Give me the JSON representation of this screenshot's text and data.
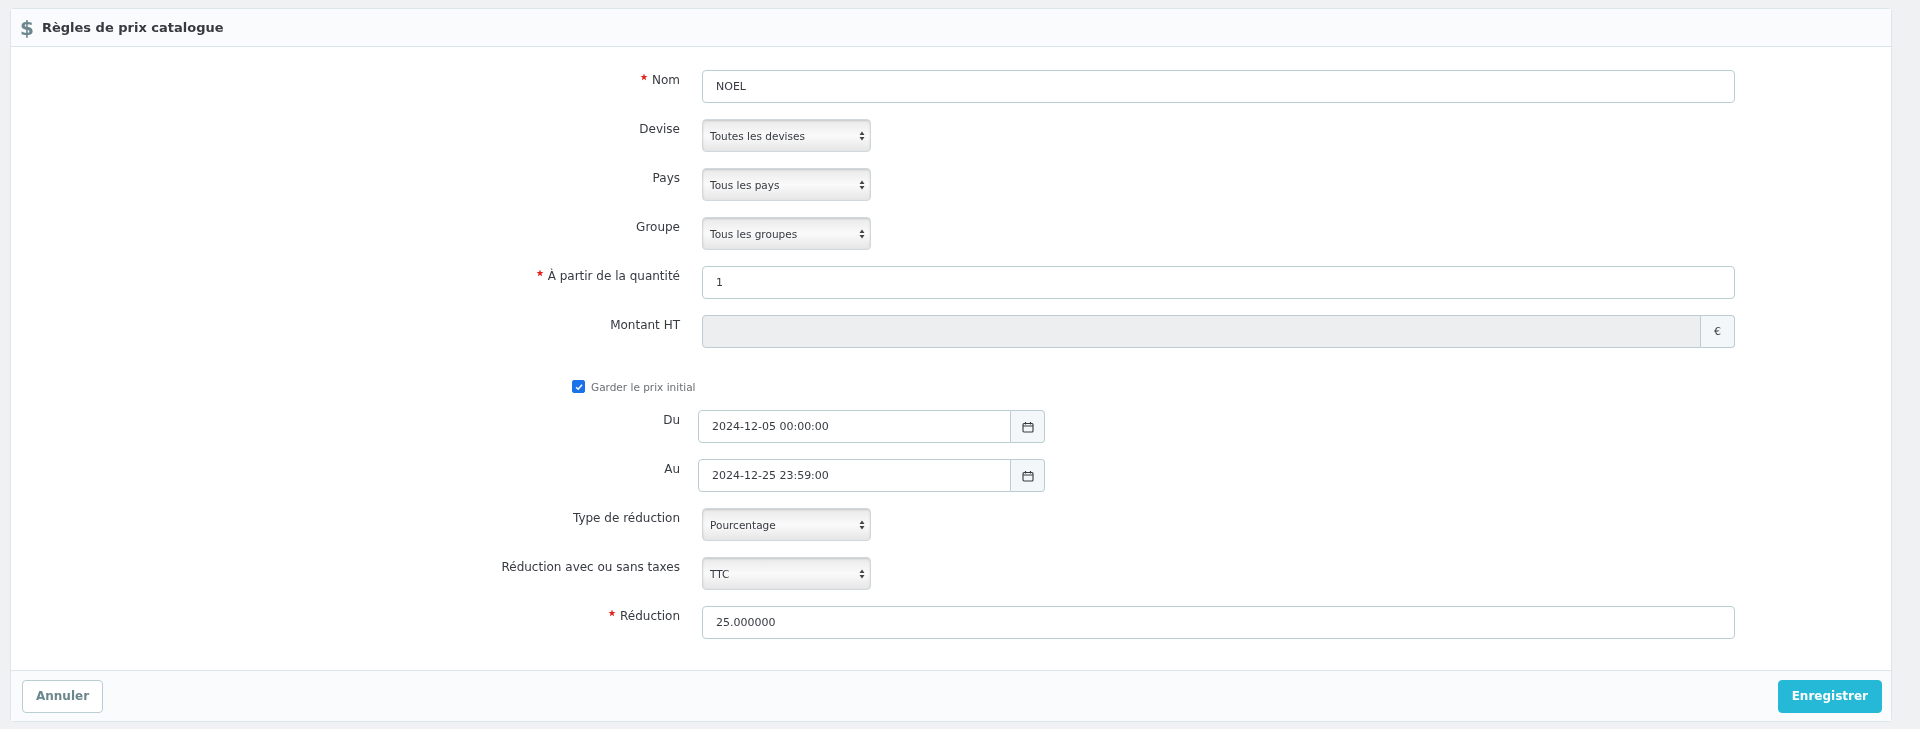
{
  "panel": {
    "icon": "$",
    "title": "Règles de prix catalogue"
  },
  "fields": [
    {
      "kind": "text",
      "label": "Nom",
      "required": true,
      "value": "NOEL"
    },
    {
      "kind": "select",
      "label": "Devise",
      "required": false,
      "value": "Toutes les devises"
    },
    {
      "kind": "select",
      "label": "Pays",
      "required": false,
      "value": "Tous les pays"
    },
    {
      "kind": "select",
      "label": "Groupe",
      "required": false,
      "value": "Tous les groupes"
    },
    {
      "kind": "text",
      "label": "À partir de la quantité",
      "required": true,
      "value": "1"
    },
    {
      "kind": "addon",
      "label": "Montant HT",
      "required": false,
      "addon": "€"
    },
    {
      "kind": "checkbox",
      "label": "Garder le prix initial",
      "required": false,
      "checked": true
    },
    {
      "kind": "date",
      "label": "Du",
      "required": false,
      "value": "2024-12-05 00:00:00"
    },
    {
      "kind": "date",
      "label": "Au",
      "required": false,
      "value": "2024-12-25 23:59:00"
    },
    {
      "kind": "select",
      "label": "Type de réduction",
      "required": false,
      "value": "Pourcentage"
    },
    {
      "kind": "select",
      "label": "Réduction avec ou sans taxes",
      "required": false,
      "value": "TTC"
    },
    {
      "kind": "text",
      "label": "Réduction",
      "required": true,
      "value": "25.000000"
    }
  ],
  "buttons": [
    {
      "kind": "secondary",
      "label": "Annuler"
    },
    {
      "kind": "primary",
      "label": "Enregistrer"
    }
  ]
}
